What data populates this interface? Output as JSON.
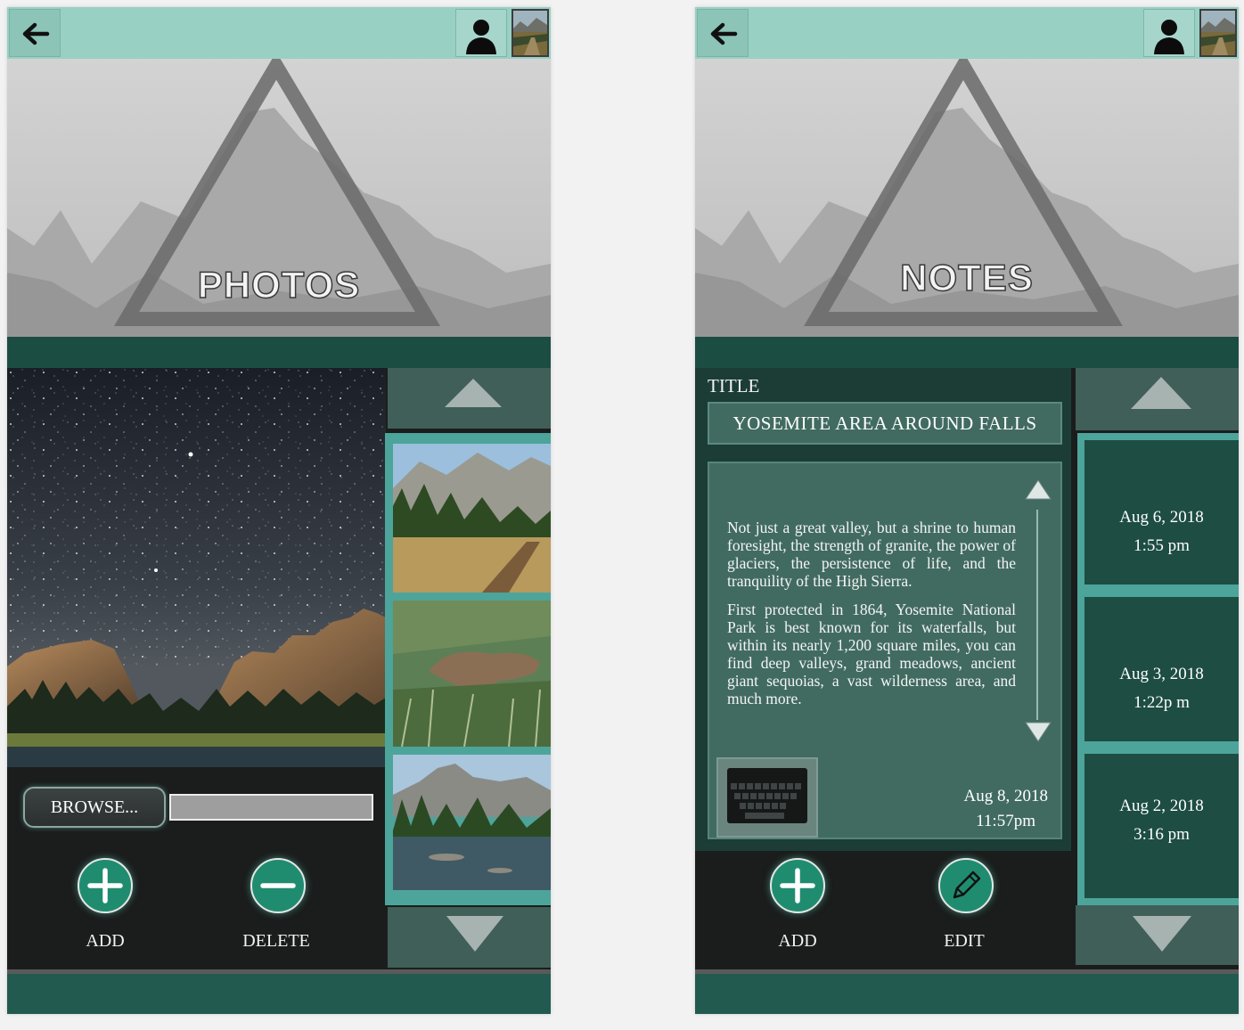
{
  "screens": {
    "photos": {
      "hero_title": "PHOTOS",
      "browse_label": "BROWSE...",
      "add_label": "ADD",
      "delete_label": "DELETE"
    },
    "notes": {
      "hero_title": "NOTES",
      "title_label": "TITLE",
      "title_value": "YOSEMITE AREA AROUND FALLS",
      "body_p1": "Not just a great valley, but a shrine to human foresight, the strength of granite, the power of glaciers, the persistence of life, and the tranquility of the High Sierra.",
      "body_p2": "First protected in 1864, Yosemite National Park is best known for its waterfalls, but within its nearly 1,200 square miles, you can find deep valleys, grand meadows, ancient giant sequoias, a vast wilderness area, and much more.",
      "note_date": "Aug 8, 2018",
      "note_time": "11:57pm",
      "add_label": "ADD",
      "edit_label": "EDIT",
      "entries": [
        {
          "date": "Aug 6, 2018",
          "time": "1:55 pm"
        },
        {
          "date": "Aug 3, 2018",
          "time": "1:22p m"
        },
        {
          "date": "Aug  2, 2018",
          "time": "3:16 pm"
        }
      ]
    }
  },
  "colors": {
    "topbar": "#99d0c4",
    "dark_band": "#1b4d43",
    "accent_teal": "#4da49a",
    "button_green": "#1f8c70",
    "note_panel": "#416b61"
  },
  "icons": [
    "back-arrow-icon",
    "user-icon",
    "landscape-thumbnail-icon",
    "arrow-up-icon",
    "arrow-down-icon",
    "plus-icon",
    "minus-icon",
    "pencil-icon",
    "keyboard-icon"
  ]
}
